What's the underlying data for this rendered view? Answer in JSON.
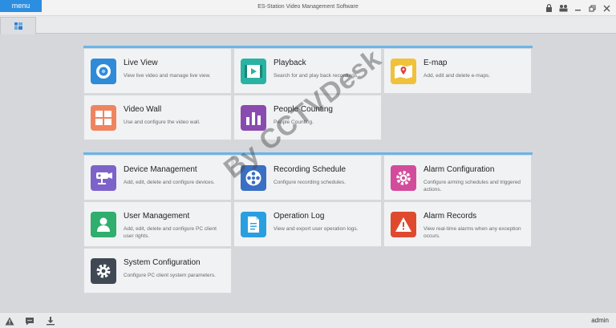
{
  "window": {
    "menu_label": "menu",
    "title": "ES-Station Video Management Software",
    "controls": [
      "lock-icon",
      "user-switch-icon",
      "minimize-icon",
      "restore-icon",
      "close-icon"
    ]
  },
  "tabs": [
    {
      "icon": "home-grid-icon"
    }
  ],
  "tiles": [
    {
      "title": "Live View",
      "desc": "View live video and manage live view.",
      "icon": "live-view-icon",
      "color": "#2f8ad8"
    },
    {
      "title": "Playback",
      "desc": "Search for and play back recordings.",
      "icon": "playback-icon",
      "color": "#29b3a3"
    },
    {
      "title": "E-map",
      "desc": "Add, edit and delete e-maps.",
      "icon": "e-map-icon",
      "color": "#f0c13a"
    },
    {
      "title": "Video Wall",
      "desc": "Use and configure the video wall.",
      "icon": "video-wall-icon",
      "color": "#ef8560"
    },
    {
      "title": "People Counting",
      "desc": "People Counting.",
      "icon": "people-counting-icon",
      "color": "#8a4bb0"
    },
    {
      "title": "Device Management",
      "desc": "Add, edit, delete and configure devices.",
      "icon": "device-management-icon",
      "color": "#7d63c9"
    },
    {
      "title": "Recording Schedule",
      "desc": "Configure recording schedules.",
      "icon": "recording-schedule-icon",
      "color": "#3b6fc3"
    },
    {
      "title": "Alarm Configuration",
      "desc": "Configure arming schedules and triggered actions.",
      "icon": "alarm-configuration-icon",
      "color": "#d34c9b"
    },
    {
      "title": "User Management",
      "desc": "Add, edit, delete and configure PC client user rights.",
      "icon": "user-management-icon",
      "color": "#2fae6d"
    },
    {
      "title": "Operation Log",
      "desc": "View and export user operation logs.",
      "icon": "operation-log-icon",
      "color": "#2a9fe0"
    },
    {
      "title": "Alarm Records",
      "desc": "View real-time alarms when any exception occurs.",
      "icon": "alarm-records-icon",
      "color": "#df4a2e"
    },
    {
      "title": "System Configuration",
      "desc": "Configure PC client system parameters.",
      "icon": "system-configuration-icon",
      "color": "#3f4853"
    }
  ],
  "watermark": "By CCTVDesk",
  "statusbar": {
    "icons": [
      "alarm-warning-icon",
      "message-icon",
      "download-icon"
    ],
    "user": "admin"
  }
}
